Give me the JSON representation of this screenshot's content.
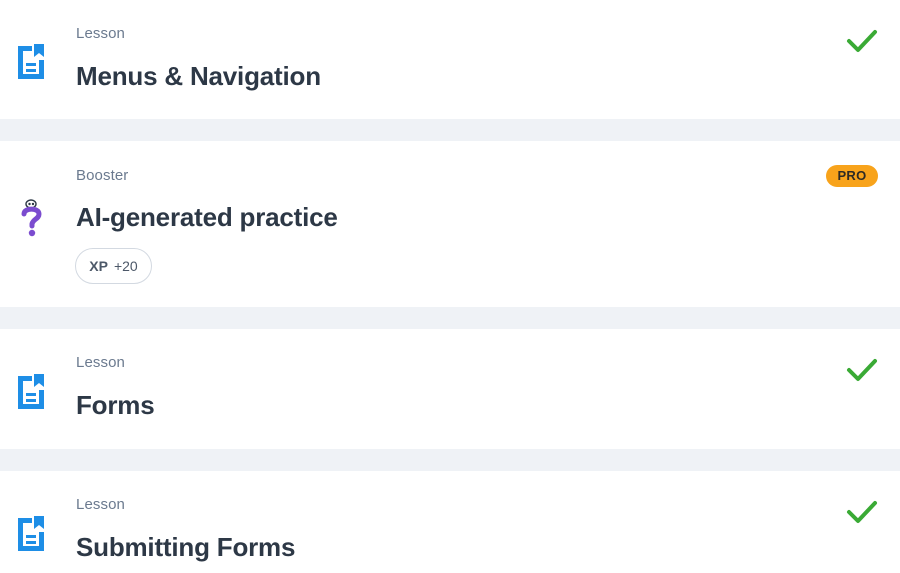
{
  "colors": {
    "background": "#eff2f6",
    "card": "#ffffff",
    "lesson_icon": "#1e8ee6",
    "check": "#3aaa35",
    "pro_badge": "#f8a31b",
    "booster_icon": "#7b4ccf"
  },
  "items": [
    {
      "type": "Lesson",
      "title": "Menus & Navigation",
      "icon": "lesson-doc-icon",
      "status": "completed",
      "status_icon": "check-icon"
    },
    {
      "type": "Booster",
      "title": "AI-generated practice",
      "icon": "question-mark-icon",
      "badge": "PRO",
      "xp_label": "XP",
      "xp_value": "+20"
    },
    {
      "type": "Lesson",
      "title": "Forms",
      "icon": "lesson-doc-icon",
      "status": "completed",
      "status_icon": "check-icon"
    },
    {
      "type": "Lesson",
      "title": "Submitting Forms",
      "icon": "lesson-doc-icon",
      "status": "completed",
      "status_icon": "check-icon"
    }
  ]
}
